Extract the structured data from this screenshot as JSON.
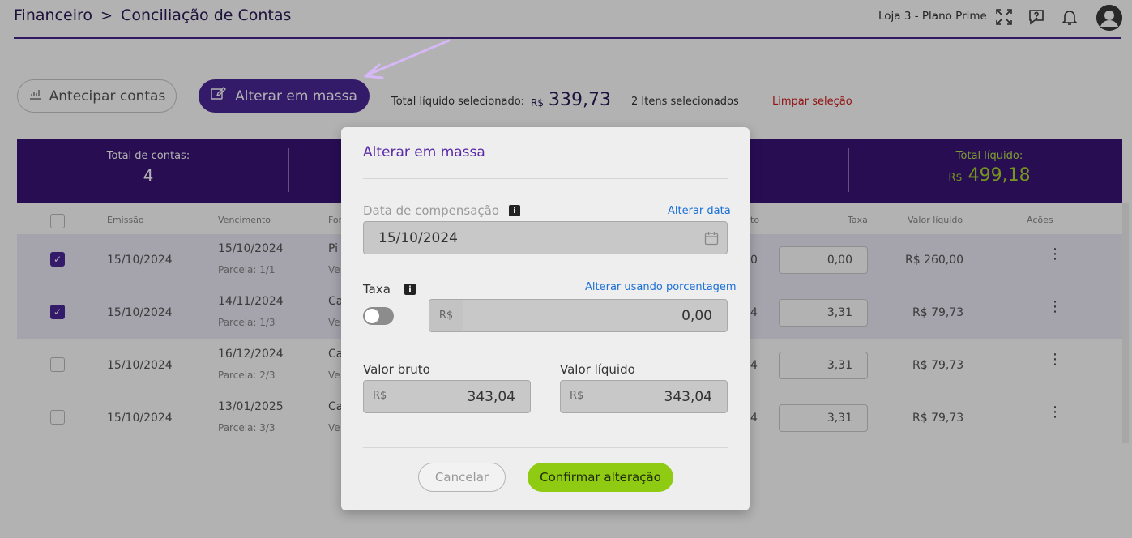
{
  "header": {
    "breadcrumb": [
      "Financeiro",
      ">",
      "Conciliação de Contas"
    ],
    "store": "Loja 3 - Plano Prime"
  },
  "toolbar": {
    "antecipar_label": "Antecipar contas",
    "massa_label": "Alterar em massa",
    "total_selected_label": "Total líquido selecionado:",
    "total_selected_currency": "R$",
    "total_selected_value": "339,73",
    "items_selected": "2 Itens selecionados",
    "clear_selection": "Limpar seleção"
  },
  "summary": {
    "total_contas_label": "Total de contas:",
    "total_contas_value": "4",
    "total_liquido_label": "Total líquido:",
    "total_liquido_currency": "R$",
    "total_liquido_value": "499,18"
  },
  "table": {
    "headers": {
      "emissao": "Emissão",
      "vencimento": "Vencimento",
      "forma": "For",
      "bruto": "to",
      "taxa": "Taxa",
      "liquido": "Valor líquido",
      "acoes": "Ações"
    },
    "rows": [
      {
        "emissao": "15/10/2024",
        "vencimento": "15/10/2024",
        "parcela": "Parcela: 1/1",
        "forma": "Pi",
        "forma_sub": "Ve",
        "bruto": "0",
        "taxa": "0,00",
        "liquido": "R$ 260,00",
        "checked": true
      },
      {
        "emissao": "15/10/2024",
        "vencimento": "14/11/2024",
        "parcela": "Parcela: 1/3",
        "forma": "Ca",
        "forma_sub": "Ve",
        "bruto": "4",
        "taxa": "3,31",
        "liquido": "R$ 79,73",
        "checked": true
      },
      {
        "emissao": "15/10/2024",
        "vencimento": "16/12/2024",
        "parcela": "Parcela: 2/3",
        "forma": "Ca",
        "forma_sub": "Ve",
        "bruto": "4",
        "taxa": "3,31",
        "liquido": "R$ 79,73",
        "checked": false
      },
      {
        "emissao": "15/10/2024",
        "vencimento": "13/01/2025",
        "parcela": "Parcela: 3/3",
        "forma": "Ca",
        "forma_sub": "Ve",
        "bruto": "4",
        "taxa": "3,31",
        "liquido": "R$ 79,73",
        "checked": false
      }
    ]
  },
  "modal": {
    "title": "Alterar em massa",
    "data_label": "Data de compensação",
    "data_link": "Alterar data",
    "data_value": "15/10/2024",
    "taxa_label": "Taxa",
    "taxa_link": "Alterar usando porcentagem",
    "taxa_currency": "R$",
    "taxa_value": "0,00",
    "taxa_toggle_on": false,
    "bruto_label": "Valor bruto",
    "bruto_currency": "R$",
    "bruto_value": "343,04",
    "liquido_label": "Valor líquido",
    "liquido_currency": "R$",
    "liquido_value": "343,04",
    "cancel_label": "Cancelar",
    "confirm_label": "Confirmar alteração"
  },
  "colors": {
    "brand_purple": "#4b2798",
    "summary_bg": "#3a1377",
    "accent_green": "#8fcb13",
    "danger_red": "#d01c1c",
    "link_blue": "#1a6fd8"
  }
}
